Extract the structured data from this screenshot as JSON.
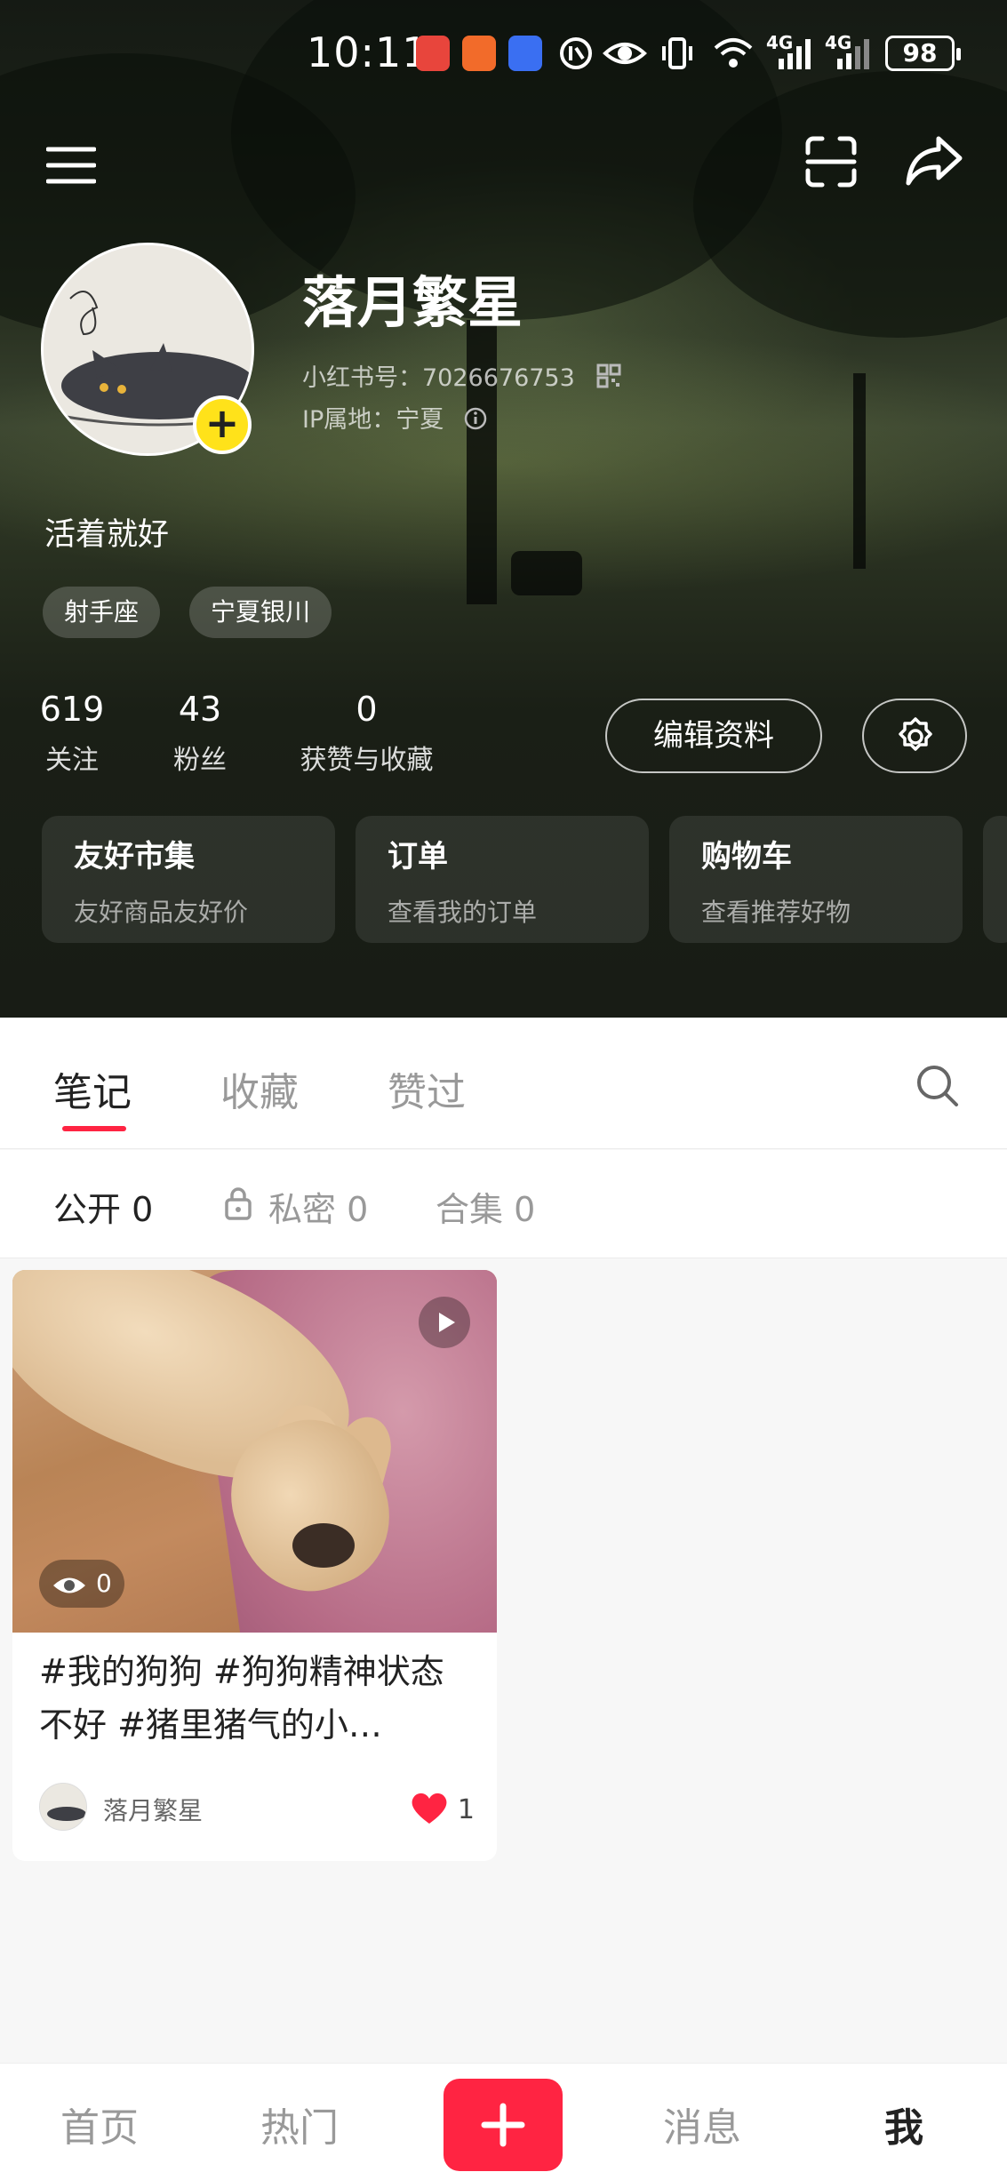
{
  "status_bar": {
    "time": "10:11",
    "network_1": "4G",
    "network_2": "4G",
    "battery": "98"
  },
  "profile": {
    "name": "落月繁星",
    "id_line": "小红书号：7026676753",
    "ip_line": "IP属地：宁夏",
    "bio": "活着就好",
    "tags": [
      "射手座",
      "宁夏银川"
    ]
  },
  "stats": [
    {
      "num": "619",
      "label": "关注"
    },
    {
      "num": "43",
      "label": "粉丝"
    },
    {
      "num": "0",
      "label": "获赞与收藏"
    }
  ],
  "actions": {
    "edit_profile": "编辑资料"
  },
  "cards": [
    {
      "title": "友好市集",
      "subtitle": "友好商品友好价"
    },
    {
      "title": "订单",
      "subtitle": "查看我的订单"
    },
    {
      "title": "购物车",
      "subtitle": "查看推荐好物"
    }
  ],
  "tabs": [
    "笔记",
    "收藏",
    "赞过"
  ],
  "subtabs": [
    "公开 0",
    "私密 0",
    "合集 0"
  ],
  "note": {
    "title": "#我的狗狗 #狗狗精神状态不好 #猪里猪气的小…",
    "views": "0",
    "author": "落月繁星",
    "likes": "1"
  },
  "bottom_nav": [
    "首页",
    "热门",
    "消息",
    "我"
  ],
  "colors": {
    "accent": "#ff2442",
    "add_badge": "#ffe21a"
  }
}
